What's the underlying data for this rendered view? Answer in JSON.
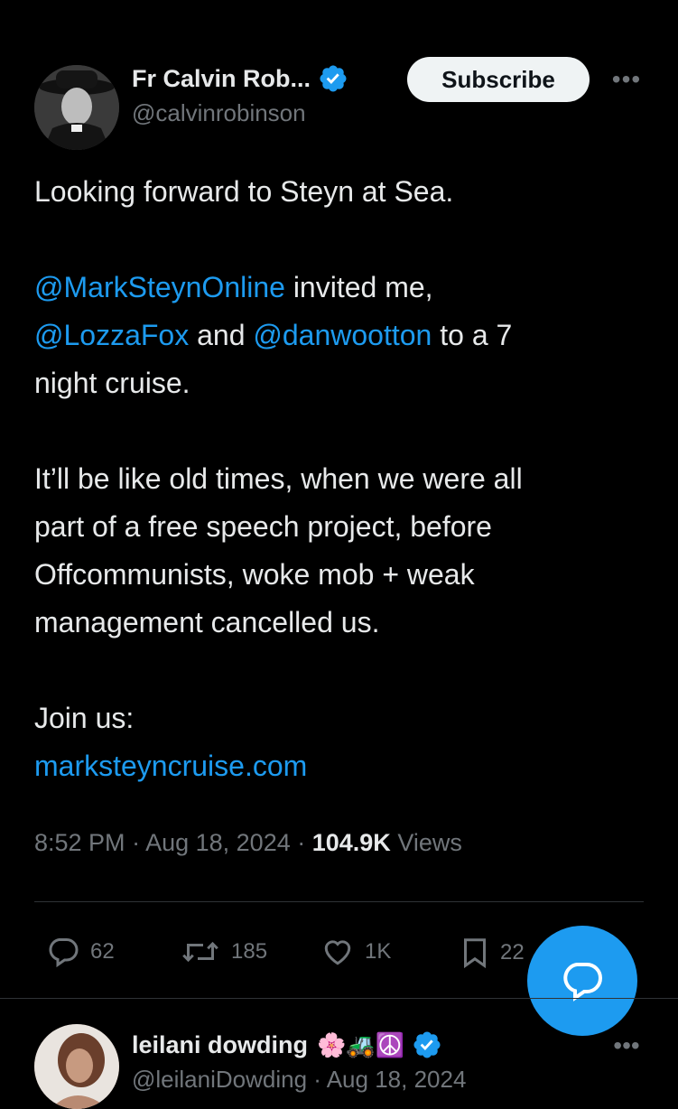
{
  "tweet": {
    "author_name": "Fr Calvin Rob...",
    "author_handle": "@calvinrobinson",
    "subscribe_label": "Subscribe",
    "more_label": "•••",
    "line1": "Looking forward to Steyn at Sea.",
    "mention1": "@MarkSteynOnline",
    "text_after_mention1": " invited me,",
    "mention2": "@LozzaFox",
    "text_and": " and ",
    "mention3": "@danwootton",
    "text_after_mention3": " to a 7",
    "text_night": "night cruise.",
    "para3_line1": "It’ll be like old times, when we were all",
    "para3_line2": "part of a free speech project, before",
    "para3_line3": "Offcommunists, woke mob + weak",
    "para3_line4": "management cancelled us.",
    "join": "Join us:",
    "link": "marksteyncruise.com",
    "time": "8:52 PM",
    "sep1": " · ",
    "date": "Aug 18, 2024",
    "sep2": " · ",
    "views_count": "104.9K",
    "views_label": " Views"
  },
  "actions": {
    "replies": "62",
    "reposts": "185",
    "likes": "1K",
    "bookmarks": "22"
  },
  "reply": {
    "author_name": "leilani dowding",
    "emojis": "🌸🚜☮️",
    "author_handle": "@leilaniDowding · Aug 18, 2024",
    "more_label": "•••"
  },
  "colors": {
    "background": "#000000",
    "text": "#e7e9ea",
    "secondary": "#71767b",
    "accent": "#1d9bf0",
    "divider": "#2f3336"
  },
  "icons": {
    "verified": "verified-badge-icon",
    "reply": "reply-icon",
    "repost": "repost-icon",
    "like": "heart-icon",
    "bookmark": "bookmark-icon",
    "compose": "compose-reply-icon",
    "more": "more-icon"
  }
}
